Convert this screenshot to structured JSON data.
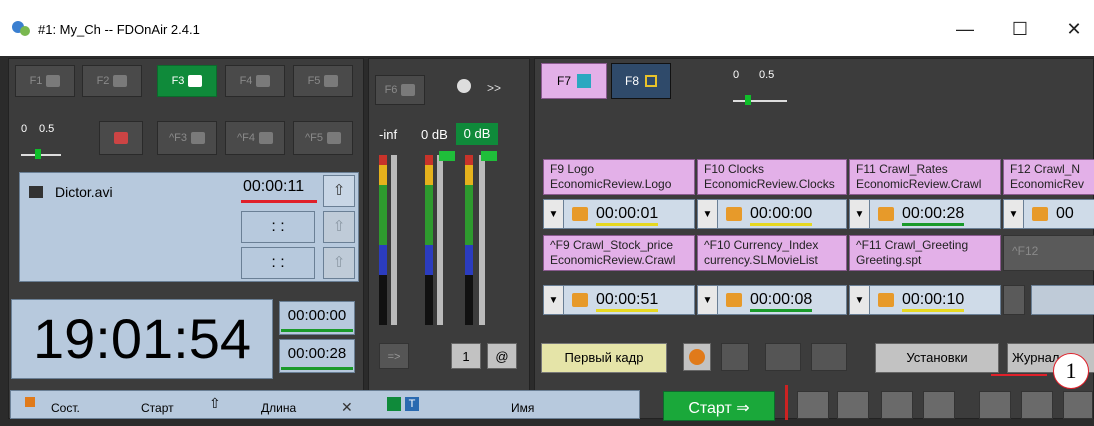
{
  "window": {
    "title": "#1: My_Ch -- FDOnAir 2.4.1",
    "minimize": "—",
    "maximize": "☐",
    "close": "✕"
  },
  "left_panel": {
    "fkeys_row1": [
      "F1",
      "F2",
      "F3",
      "F4",
      "F5"
    ],
    "fkeys_row2": [
      "^F3",
      "^F4",
      "^F5"
    ],
    "active_key": "F3",
    "scale": {
      "min": "0",
      "max": "0.5"
    },
    "clip": {
      "name": "Dictor.avi",
      "time": "00:00:11"
    },
    "empty_time": ": :",
    "clock": "19:01:54",
    "time_top": "00:00:00",
    "time_bottom": "00:00:28",
    "up_arrow": "⇧"
  },
  "middle_panel": {
    "f6": "F6",
    "more": ">>",
    "inf": "-inf",
    "db0": "0 dB",
    "db0_active": "0 dB",
    "btn_arrow": "=>",
    "btn_1": "1",
    "btn_at": "@"
  },
  "right_panel": {
    "f7": "F7",
    "f8": "F8",
    "scale": {
      "min": "0",
      "max": "0.5"
    },
    "row1": [
      {
        "key": "F9 Logo",
        "file": "EconomicReview.Logo",
        "time": "00:00:01"
      },
      {
        "key": "F10 Clocks",
        "file": "EconomicReview.Clocks",
        "time": "00:00:00"
      },
      {
        "key": "F11 Crawl_Rates",
        "file": "EconomicReview.Crawl",
        "time": "00:00:28"
      },
      {
        "key": "F12 Crawl_N",
        "file": "EconomicRev",
        "time": "00"
      }
    ],
    "row2": [
      {
        "key": "^F9 Crawl_Stock_price",
        "file": "EconomicReview.Crawl",
        "time": "00:00:51"
      },
      {
        "key": "^F10 Currency_Index",
        "file": "currency.SLMovieList",
        "time": "00:00:08"
      },
      {
        "key": "^F11 Crawl_Greeting",
        "file": "Greeting.spt",
        "time": "00:00:10"
      },
      {
        "key": "^F12",
        "file": "",
        "time": ""
      }
    ],
    "first_frame": "Первый кадр",
    "settings": "Установки",
    "journal": "Журнал",
    "callout": "1"
  },
  "bottom": {
    "col_state": "Сост.",
    "col_start": "Старт",
    "col_length": "Длина",
    "col_name": "Имя",
    "start_button": "Старт ⇒"
  },
  "colors": {
    "active_green": "#0f8a3a",
    "pink": "#e3b0e8",
    "timecell": "#b7c9dd",
    "red_underline": "#e0202a"
  }
}
